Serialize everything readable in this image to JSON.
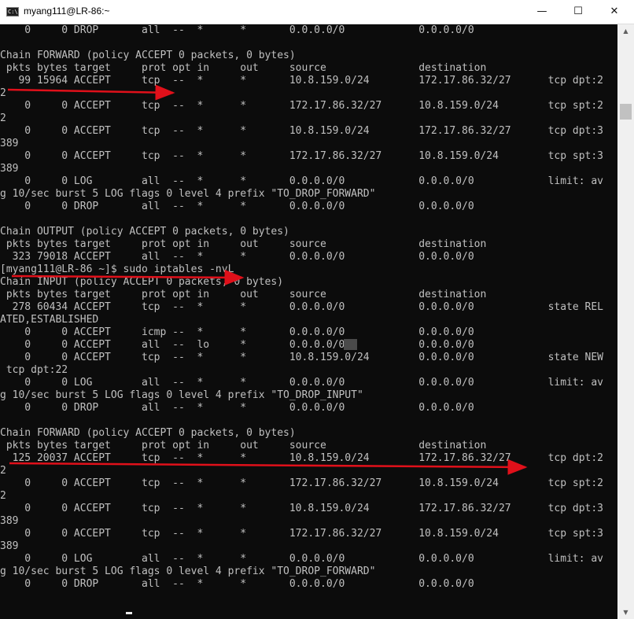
{
  "window": {
    "title": "myang111@LR-86:~",
    "app_icon_text": "C:\\.",
    "minimize_glyph": "—",
    "maximize_glyph": "☐",
    "close_glyph": "✕"
  },
  "terminal": {
    "lines": [
      "    0     0 DROP       all  --  *      *       0.0.0.0/0            0.0.0.0/0",
      "",
      "Chain FORWARD (policy ACCEPT 0 packets, 0 bytes)",
      " pkts bytes target     prot opt in     out     source               destination",
      "   99 15964 ACCEPT     tcp  --  *      *       10.8.159.0/24        172.17.86.32/27      tcp dpt:2",
      "2",
      "    0     0 ACCEPT     tcp  --  *      *       172.17.86.32/27      10.8.159.0/24        tcp spt:2",
      "2",
      "    0     0 ACCEPT     tcp  --  *      *       10.8.159.0/24        172.17.86.32/27      tcp dpt:3",
      "389",
      "    0     0 ACCEPT     tcp  --  *      *       172.17.86.32/27      10.8.159.0/24        tcp spt:3",
      "389",
      "    0     0 LOG        all  --  *      *       0.0.0.0/0            0.0.0.0/0            limit: av",
      "g 10/sec burst 5 LOG flags 0 level 4 prefix \"TO_DROP_FORWARD\"",
      "    0     0 DROP       all  --  *      *       0.0.0.0/0            0.0.0.0/0",
      "",
      "Chain OUTPUT (policy ACCEPT 0 packets, 0 bytes)",
      " pkts bytes target     prot opt in     out     source               destination",
      "  323 79018 ACCEPT     all  --  *      *       0.0.0.0/0            0.0.0.0/0",
      "[myang111@LR-86 ~]$ sudo iptables -nvL",
      "Chain INPUT (policy ACCEPT 0 packets, 0 bytes)",
      " pkts bytes target     prot opt in     out     source               destination",
      "  278 60434 ACCEPT     tcp  --  *      *       0.0.0.0/0            0.0.0.0/0            state REL",
      "ATED,ESTABLISHED",
      "    0     0 ACCEPT     icmp --  *      *       0.0.0.0/0            0.0.0.0/0",
      "    0     0 ACCEPT     all  --  lo     *       0.0.0.0/0            0.0.0.0/0",
      "    0     0 ACCEPT     tcp  --  *      *       10.8.159.0/24        0.0.0.0/0            state NEW",
      " tcp dpt:22",
      "    0     0 LOG        all  --  *      *       0.0.0.0/0            0.0.0.0/0            limit: av",
      "g 10/sec burst 5 LOG flags 0 level 4 prefix \"TO_DROP_INPUT\"",
      "    0     0 DROP       all  --  *      *       0.0.0.0/0            0.0.0.0/0",
      "",
      "Chain FORWARD (policy ACCEPT 0 packets, 0 bytes)",
      " pkts bytes target     prot opt in     out     source               destination",
      "  125 20037 ACCEPT     tcp  --  *      *       10.8.159.0/24        172.17.86.32/27      tcp dpt:2",
      "2",
      "    0     0 ACCEPT     tcp  --  *      *       172.17.86.32/27      10.8.159.0/24        tcp spt:2",
      "2",
      "    0     0 ACCEPT     tcp  --  *      *       10.8.159.0/24        172.17.86.32/27      tcp dpt:3",
      "389",
      "    0     0 ACCEPT     tcp  --  *      *       172.17.86.32/27      10.8.159.0/24        tcp spt:3",
      "389",
      "    0     0 LOG        all  --  *      *       0.0.0.0/0            0.0.0.0/0            limit: av",
      "g 10/sec burst 5 LOG flags 0 level 4 prefix \"TO_DROP_FORWARD\"",
      "    0     0 DROP       all  --  *      *       0.0.0.0/0            0.0.0.0/0"
    ]
  },
  "colors": {
    "terminal_bg": "#0c0c0c",
    "terminal_fg": "#c0c0c0",
    "arrow": "#e0101a",
    "titlebar_bg": "#ffffff"
  }
}
